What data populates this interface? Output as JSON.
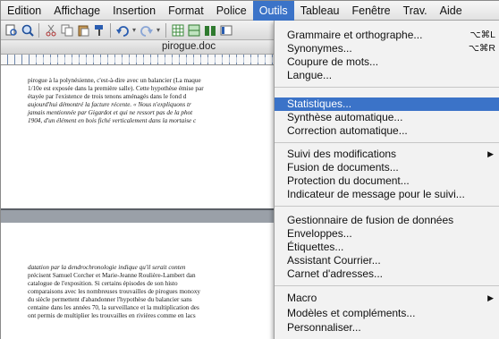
{
  "menubar": {
    "items": [
      "Edition",
      "Affichage",
      "Insertion",
      "Format",
      "Police",
      "Outils",
      "Tableau",
      "Fenêtre",
      "Trav.",
      "Aide"
    ]
  },
  "document": {
    "title": "pirogue.doc",
    "page1_lines": [
      "pirogue à la polynésienne, c'est-à-dire avec un balancier (La maque",
      "1/10e est exposée dans la première salle). Cette hypothèse émise par",
      "étayée par l'existence de trois tenons aménagés dans le fond d",
      "aujourd'hui démontré la facture récente. « Nous n'expliquons tr",
      "jamais mentionnée par Gigardot et qui ne ressort pas de la phot",
      "1904, d'un élément en bois fiché verticalement dans la mortaise c"
    ],
    "page2_lines": [
      "datation par la dendrochronologie indique qu'il serait conten",
      "précisent Samuel Corcher et Marie-Jeanne Roulière-Lambert dan",
      "catalogue de l'exposition. Si certains épisodes de son histo",
      "comparaisons avec les nombreuses trouvailles de pirogues monoxy",
      "du siècle permettent d'abandonner l'hypothèse du balancier sans",
      "centaine dans les années 70, la surveillance et la multiplication des",
      "ont permis de multiplier les trouvailles en rivières comme en lacs"
    ]
  },
  "outils_menu": {
    "grammaire": "Grammaire et orthographe...",
    "grammaire_shortcut": "⌥⌘L",
    "synonymes": "Synonymes...",
    "synonymes_shortcut": "⌥⌘R",
    "coupure": "Coupure de mots...",
    "langue": "Langue...",
    "statistiques": "Statistiques...",
    "synthese": "Synthèse automatique...",
    "correction": "Correction automatique...",
    "suivi": "Suivi des modifications",
    "fusion": "Fusion de documents...",
    "protection": "Protection du document...",
    "indicateur": "Indicateur de message pour le suivi...",
    "gestionnaire": "Gestionnaire de fusion de données",
    "enveloppes": "Enveloppes...",
    "etiquettes": "Étiquettes...",
    "assistant": "Assistant Courrier...",
    "carnet": "Carnet d'adresses...",
    "macro": "Macro",
    "modeles": "Modèles et compléments...",
    "personnaliser": "Personnaliser..."
  }
}
